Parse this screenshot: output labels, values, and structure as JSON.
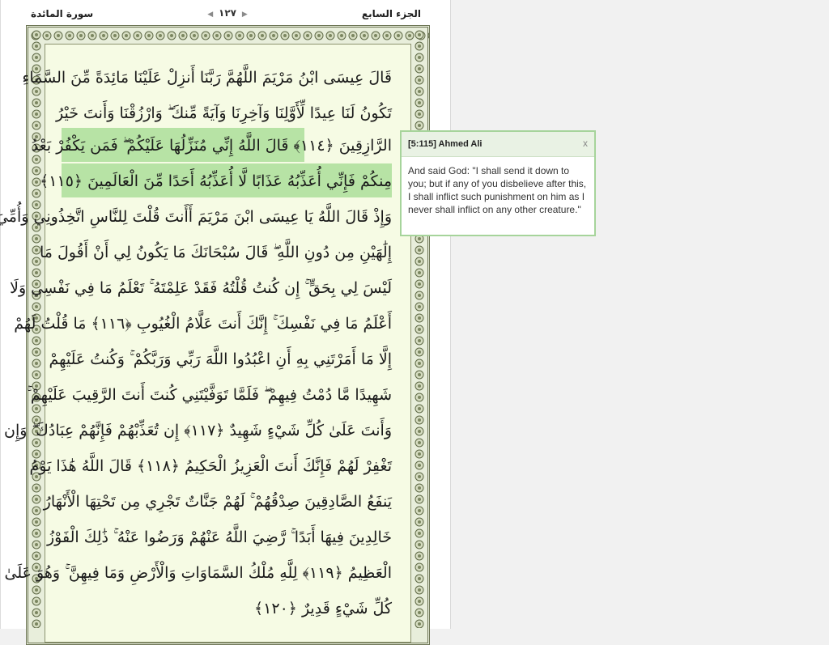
{
  "header": {
    "juz": "الجزء السابع",
    "surah": "سورة المائدة",
    "page_number": "١٢٧",
    "prev_arrow": "◀",
    "next_arrow": "▶"
  },
  "lines": [
    "قَالَ عِيسَى ابْنُ مَرْيَمَ اللَّهُمَّ رَبَّنَا أَنزِلْ عَلَيْنَا مَائِدَةً مِّنَ السَّمَاءِ",
    "تَكُونُ لَنَا عِيدًا لِّأَوَّلِنَا وَآخِرِنَا وَآيَةً مِّنكَ ۖ وَارْزُقْنَا وَأَنتَ خَيْرُ",
    "الرَّازِقِينَ ﴿١١٤﴾ قَالَ اللَّهُ إِنِّي مُنَزِّلُهَا عَلَيْكُمْ ۖ فَمَن يَكْفُرْ بَعْدُ",
    "مِنكُمْ فَإِنِّي أُعَذِّبُهُ عَذَابًا لَّا أُعَذِّبُهُ أَحَدًا مِّنَ الْعَالَمِينَ ﴿١١٥﴾",
    "وَإِذْ قَالَ اللَّهُ يَا عِيسَى ابْنَ مَرْيَمَ أَأَنتَ قُلْتَ لِلنَّاسِ اتَّخِذُونِي وَأُمِّيَ",
    "إِلَٰهَيْنِ مِن دُونِ اللَّهِ ۖ قَالَ سُبْحَانَكَ مَا يَكُونُ لِي أَنْ أَقُولَ مَا",
    "لَيْسَ لِي بِحَقٍّ ۚ إِن كُنتُ قُلْتُهُ فَقَدْ عَلِمْتَهُ ۚ تَعْلَمُ مَا فِي نَفْسِي وَلَا",
    "أَعْلَمُ مَا فِي نَفْسِكَ ۚ إِنَّكَ أَنتَ عَلَّامُ الْغُيُوبِ ﴿١١٦﴾ مَا قُلْتُ لَهُمْ",
    "إِلَّا مَا أَمَرْتَنِي بِهِ أَنِ اعْبُدُوا اللَّهَ رَبِّي وَرَبَّكُمْ ۚ وَكُنتُ عَلَيْهِمْ",
    "شَهِيدًا مَّا دُمْتُ فِيهِمْ ۖ فَلَمَّا تَوَفَّيْتَنِي كُنتَ أَنتَ الرَّقِيبَ عَلَيْهِمْ ۚ",
    "وَأَنتَ عَلَىٰ كُلِّ شَيْءٍ شَهِيدٌ ﴿١١٧﴾ إِن تُعَذِّبْهُمْ فَإِنَّهُمْ عِبَادُكَ ۖ وَإِن",
    "تَغْفِرْ لَهُمْ فَإِنَّكَ أَنتَ الْعَزِيزُ الْحَكِيمُ ﴿١١٨﴾ قَالَ اللَّهُ هَٰذَا يَوْمُ",
    "يَنفَعُ الصَّادِقِينَ صِدْقُهُمْ ۚ لَهُمْ جَنَّاتٌ تَجْرِي مِن تَحْتِهَا الْأَنْهَارُ",
    "خَالِدِينَ فِيهَا أَبَدًا ۚ رَّضِيَ اللَّهُ عَنْهُمْ وَرَضُوا عَنْهُ ۚ ذَٰلِكَ الْفَوْزُ",
    "الْعَظِيمُ ﴿١١٩﴾ لِلَّهِ مُلْكُ السَّمَاوَاتِ وَالْأَرْضِ وَمَا فِيهِنَّ ۚ وَهُوَ عَلَىٰ",
    "كُلِّ شَيْءٍ قَدِيرٌ ﴿١٢٠﴾"
  ],
  "tooltip": {
    "title": "[5:115] Ahmed Ali",
    "close": "x",
    "body": "And said God: \"I shall send it down to you; but if any of you disbelieve after this, I shall inflict such punishment on him as I never shall inflict on any other creature.\""
  },
  "colors": {
    "highlight": "#b7e3a5",
    "page_bg": "#f6fbe4",
    "frame": "#6e7656",
    "tooltip_border": "#a6d49b"
  },
  "icons": {
    "prev": "triangle-left-icon",
    "next": "triangle-right-icon",
    "ornament": "circle-ornament"
  }
}
